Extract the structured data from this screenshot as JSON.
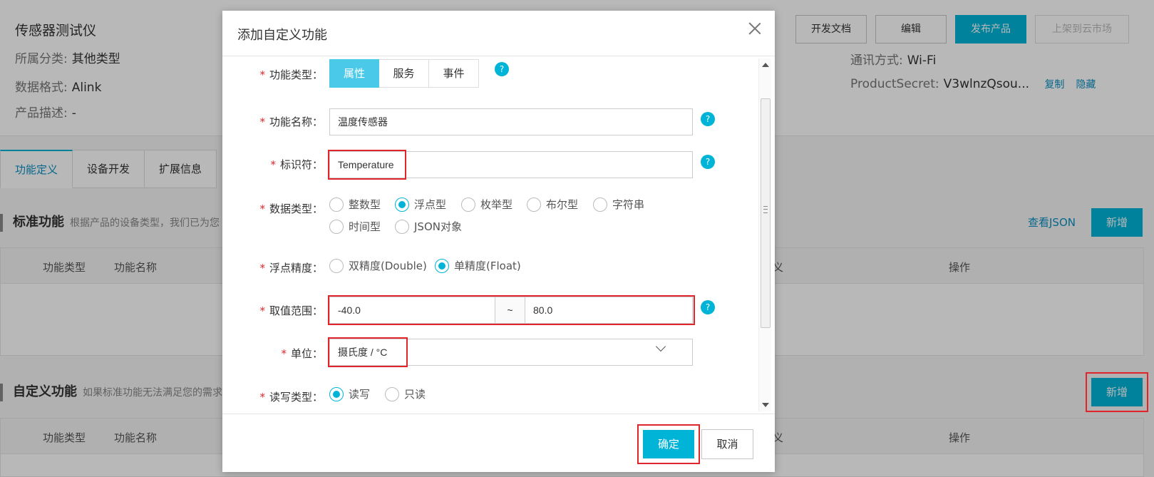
{
  "product": {
    "name": "传感器测试仪",
    "category_label": "所属分类:",
    "category_value": "其他类型",
    "format_label": "数据格式:",
    "format_value": "Alink",
    "desc_label": "产品描述:",
    "desc_value": "-",
    "comm_label": "通讯方式:",
    "comm_value": "Wi-Fi",
    "secret_label": "ProductSecret:",
    "secret_value": "V3wlnzQsou...",
    "copy_link": "复制",
    "hide_link": "隐藏"
  },
  "header_buttons": {
    "docs": "开发文档",
    "edit": "编辑",
    "publish": "发布产品",
    "market": "上架到云市场"
  },
  "tabs": [
    "功能定义",
    "设备开发",
    "扩展信息"
  ],
  "standard": {
    "title": "标准功能",
    "desc": "根据产品的设备类型，我们已为您",
    "view_json": "查看JSON",
    "add": "新增",
    "columns": [
      "功能类型",
      "功能名称",
      "义",
      "操作"
    ]
  },
  "custom": {
    "title": "自定义功能",
    "desc": "如果标准功能无法满足您的需求",
    "add": "新增",
    "columns": [
      "功能类型",
      "功能名称",
      "义",
      "操作"
    ]
  },
  "dialog": {
    "title": "添加自定义功能",
    "func_type_label": "功能类型：",
    "func_types": [
      "属性",
      "服务",
      "事件"
    ],
    "func_name_label": "功能名称：",
    "func_name_value": "温度传感器",
    "identifier_label": "标识符：",
    "identifier_value": "Temperature",
    "data_type_label": "数据类型：",
    "data_types": [
      "整数型",
      "浮点型",
      "枚举型",
      "布尔型",
      "字符串",
      "时间型",
      "JSON对象"
    ],
    "precision_label": "浮点精度：",
    "precision_options": [
      "双精度(Double)",
      "单精度(Float)"
    ],
    "range_label": "取值范围：",
    "range_min": "-40.0",
    "range_sep": "~",
    "range_max": "80.0",
    "unit_label": "单位：",
    "unit_value": "摄氏度 / °C",
    "rw_label": "读写类型：",
    "rw_options": [
      "读写",
      "只读"
    ],
    "help_symbol": "?",
    "required_mark": "*",
    "ok": "确定",
    "cancel": "取消"
  },
  "colors": {
    "accent": "#00b4d8",
    "highlight": "#e0262b",
    "link": "#0a8fc1"
  }
}
